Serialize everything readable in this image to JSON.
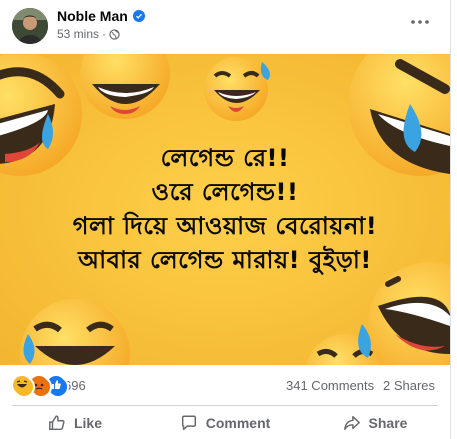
{
  "post": {
    "author": "Noble Man",
    "time": "53 mins",
    "privacy_dot": "·",
    "image_text": [
      "লেগেন্ড রে!!",
      "ওরে লেগেন্ড!!",
      "গলা দিয়ে আওয়াজ বেরোয়না!",
      "আবার লেগেন্ড মারায়! বুইড়া!"
    ],
    "reaction_count": "696",
    "comments": "341 Comments",
    "shares": "2 Shares",
    "reaction_types": [
      "haha",
      "angry",
      "like"
    ]
  },
  "actions": {
    "like": "Like",
    "comment": "Comment",
    "share": "Share"
  },
  "colors": {
    "background_yellow": "#f6c23c",
    "verified_blue": "#1877f2",
    "muted_text": "#65676b"
  }
}
